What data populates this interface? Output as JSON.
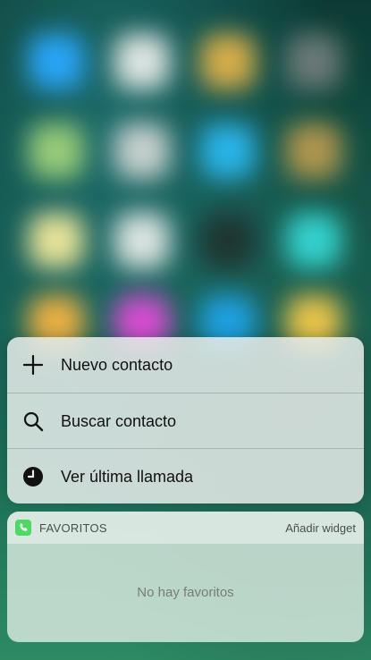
{
  "quick_actions": {
    "items": [
      {
        "label": "Nuevo contacto",
        "icon": "plus-icon"
      },
      {
        "label": "Buscar contacto",
        "icon": "search-icon"
      },
      {
        "label": "Ver última llamada",
        "icon": "clock-icon"
      }
    ]
  },
  "widget": {
    "title": "FAVORITOS",
    "action": "Añadir widget",
    "empty_text": "No hay favoritos",
    "icon": "phone-icon",
    "accent": "#4cd964"
  }
}
